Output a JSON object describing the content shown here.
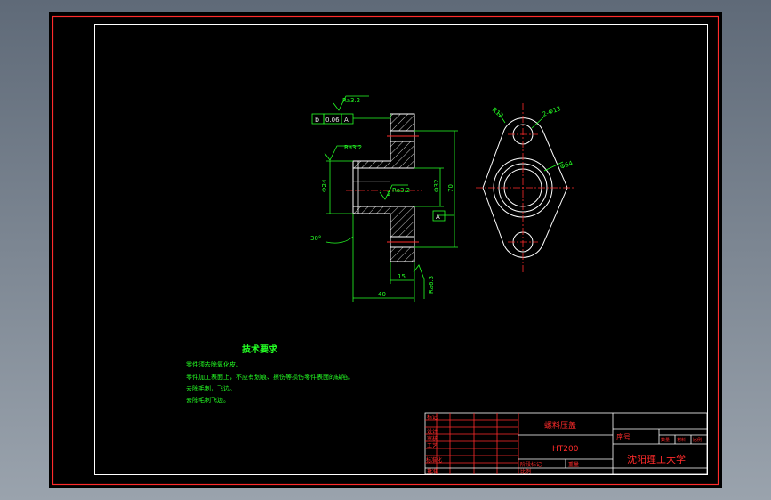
{
  "technical_requirements": {
    "title": "技术要求",
    "lines": [
      "零件须去除氧化皮。",
      "零件加工表面上，不应有划痕、擦伤等损伤零件表面的缺陷。",
      "去除毛刺，飞边。",
      "去除毛刺飞边。"
    ]
  },
  "title_block": {
    "part_name": "螺料压盖",
    "material": "HT200",
    "school": "沈阳理工大学",
    "seq_label": "序号",
    "small_cells": [
      "数量",
      "材料",
      "比例"
    ],
    "row_labels": [
      "标记",
      "设计",
      "审核",
      "工艺",
      "标准化",
      "批准"
    ],
    "bottom_labels": [
      "阶段标记",
      "重量",
      "比例",
      "共 张",
      "第 张"
    ]
  },
  "annotations": {
    "roughness_top": "Ra3.2",
    "roughness_mid": "Ra3.2",
    "roughness_inner": "Ra3.2",
    "roughness_bottom": "Ra6.3",
    "gdt_symbol": "b",
    "gdt_value": "0.06",
    "gdt_datum": "A",
    "datum_a": "A",
    "dim_bore": "Φ24",
    "dim_inner": "Φ32",
    "dim_outer": "70",
    "dim_chamfer": "30°",
    "dim_width": "40",
    "dim_flange": "15",
    "dim_hole": "2-Φ13",
    "dim_radius": "R12",
    "dim_circle": "Φ64",
    "dim_small": "2"
  },
  "colors": {
    "frame": "#ff2b2b",
    "outline": "#ffffff",
    "dimension": "#24ff24",
    "text": "#24ff24"
  }
}
